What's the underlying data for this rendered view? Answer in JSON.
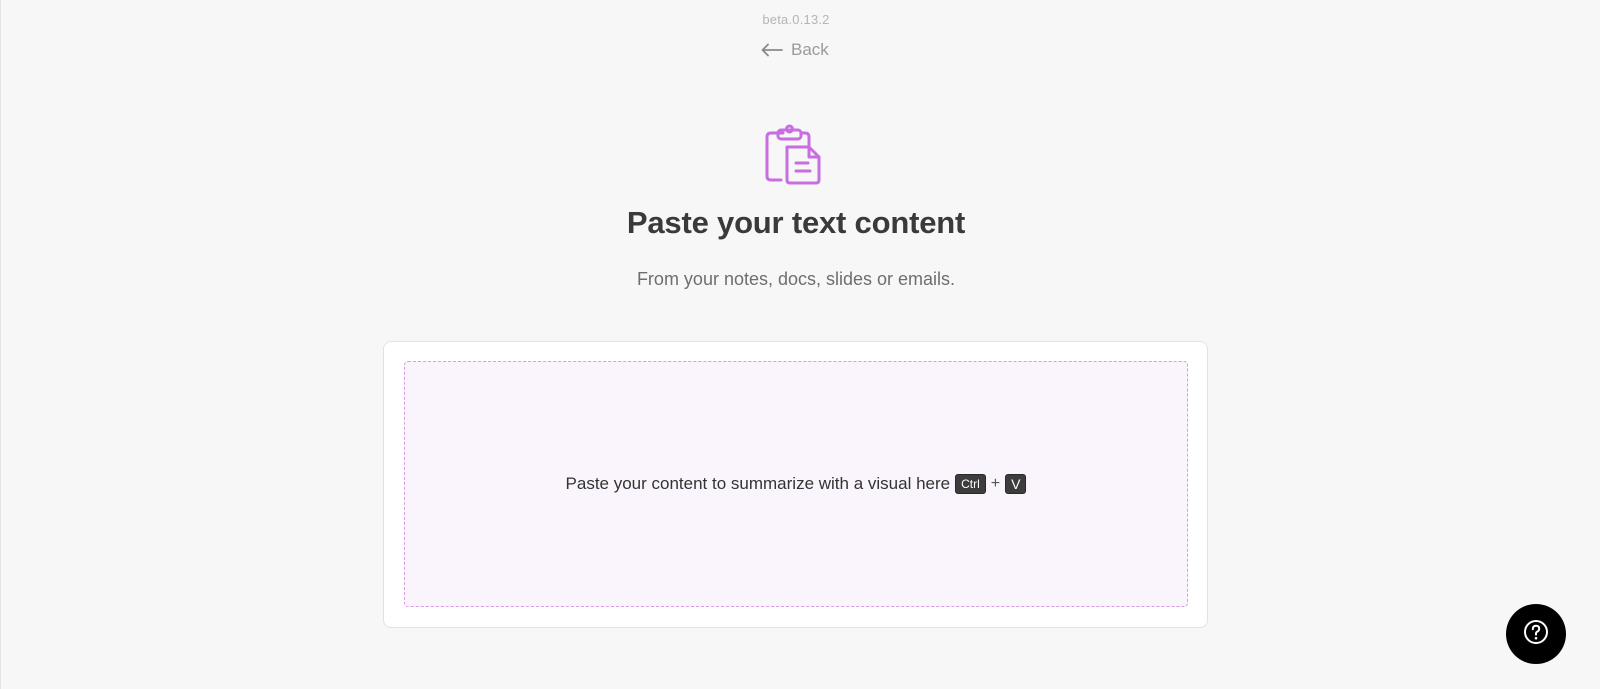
{
  "header": {
    "version": "beta.0.13.2",
    "back_label": "Back"
  },
  "hero": {
    "icon": "clipboard-document-icon",
    "title": "Paste your text content",
    "subtitle": "From your notes, docs, slides or emails."
  },
  "paste_area": {
    "instruction": "Paste your content to summarize with a visual here",
    "shortcut_key_1": "Ctrl",
    "shortcut_separator": "+",
    "shortcut_key_2": "V"
  },
  "help": {
    "icon": "question-circle-icon"
  },
  "colors": {
    "accent": "#c86ee0",
    "background": "#f7f7f7",
    "dropzone_bg": "#faf5fc",
    "dropzone_border": "#d79be8",
    "help_button": "#000000"
  }
}
